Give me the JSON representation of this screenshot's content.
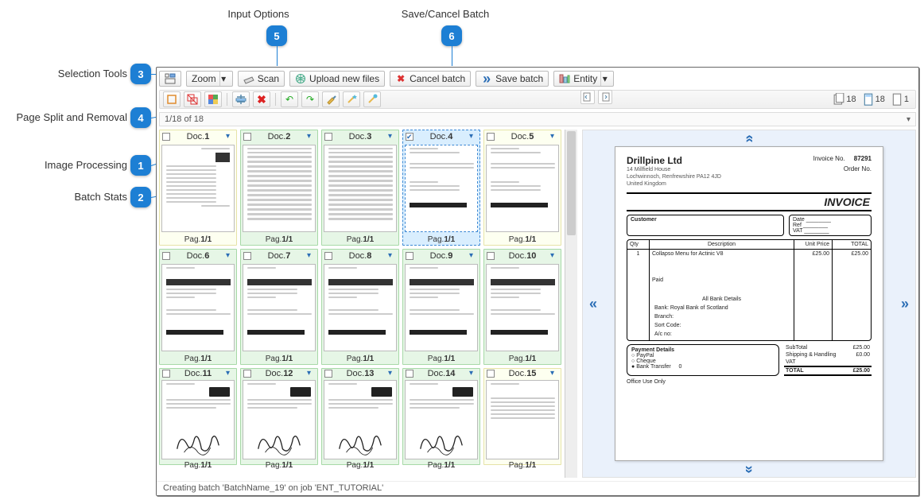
{
  "callouts": {
    "c1": {
      "label": "Image Processing",
      "num": "1"
    },
    "c2": {
      "label": "Batch Stats",
      "num": "2"
    },
    "c3": {
      "label": "Selection Tools",
      "num": "3"
    },
    "c4": {
      "label": "Page Split and Removal",
      "num": "4"
    },
    "c5": {
      "label": "Input Options",
      "num": "5"
    },
    "c6": {
      "label": "Save/Cancel Batch",
      "num": "6"
    }
  },
  "toolbar": {
    "zoom": "Zoom",
    "scan": "Scan",
    "upload": "Upload new files",
    "cancel": "Cancel batch",
    "save": "Save batch",
    "entity": "Entity"
  },
  "stats": {
    "s1": "18",
    "s2": "18",
    "s3": "1"
  },
  "position": "1/18 of 18",
  "docs": [
    {
      "id": "d1",
      "name": "Doc.",
      "num": "1",
      "pag": "Pag.",
      "pp": "1/1",
      "variant": "lite",
      "mock": "inv"
    },
    {
      "id": "d2",
      "name": "Doc.",
      "num": "2",
      "pag": "Pag.",
      "pp": "1/1",
      "variant": "grn",
      "mock": "table"
    },
    {
      "id": "d3",
      "name": "Doc.",
      "num": "3",
      "pag": "Pag.",
      "pp": "1/1",
      "variant": "grn",
      "mock": "table"
    },
    {
      "id": "d4",
      "name": "Doc.",
      "num": "4",
      "pag": "Pag.",
      "pp": "1/1",
      "variant": "sel",
      "mock": "form",
      "checked": true
    },
    {
      "id": "d5",
      "name": "Doc.",
      "num": "5",
      "pag": "Pag.",
      "pp": "1/1",
      "variant": "lite",
      "mock": "form2"
    },
    {
      "id": "d6",
      "name": "Doc.",
      "num": "6",
      "pag": "Pag.",
      "pp": "1/1",
      "variant": "grn",
      "mock": "letter"
    },
    {
      "id": "d7",
      "name": "Doc.",
      "num": "7",
      "pag": "Pag.",
      "pp": "1/1",
      "variant": "grn",
      "mock": "letter"
    },
    {
      "id": "d8",
      "name": "Doc.",
      "num": "8",
      "pag": "Pag.",
      "pp": "1/1",
      "variant": "grn",
      "mock": "letter"
    },
    {
      "id": "d9",
      "name": "Doc.",
      "num": "9",
      "pag": "Pag.",
      "pp": "1/1",
      "variant": "grn",
      "mock": "letter"
    },
    {
      "id": "d10",
      "name": "Doc.",
      "num": "10",
      "pag": "Pag.",
      "pp": "1/1",
      "variant": "grn",
      "mock": "letter"
    },
    {
      "id": "d11",
      "name": "Doc.",
      "num": "11",
      "pag": "Pag.",
      "pp": "1/1",
      "variant": "grn",
      "mock": "scrib"
    },
    {
      "id": "d12",
      "name": "Doc.",
      "num": "12",
      "pag": "Pag.",
      "pp": "1/1",
      "variant": "grn",
      "mock": "scrib"
    },
    {
      "id": "d13",
      "name": "Doc.",
      "num": "13",
      "pag": "Pag.",
      "pp": "1/1",
      "variant": "grn",
      "mock": "scrib"
    },
    {
      "id": "d14",
      "name": "Doc.",
      "num": "14",
      "pag": "Pag.",
      "pp": "1/1",
      "variant": "grn",
      "mock": "scrib"
    },
    {
      "id": "d15",
      "name": "Doc.",
      "num": "15",
      "pag": "Pag.",
      "pp": "1/1",
      "variant": "lite",
      "mock": "google"
    }
  ],
  "invoice": {
    "company": "Drillpine Ltd",
    "addr1": "14 Millfield House",
    "addr2": "Lochwinnoch, Renfrewshire PA12 4JD",
    "addr3": "United Kingdom",
    "invno_lbl": "Invoice No.",
    "invno": "87291",
    "ordno_lbl": "Order No.",
    "title": "INVOICE",
    "cust_lbl": "Customer",
    "date_lbl": "Date",
    "ref_lbl": "Ref",
    "vat_lbl": "VAT",
    "th_qty": "Qty",
    "th_desc": "Description",
    "th_up": "Unit Price",
    "th_tot": "TOTAL",
    "row1_qty": "1",
    "row1_desc": "Collapso Menu for Actinic V8",
    "row1_up": "£25.00",
    "row1_tot": "£25.00",
    "paid": "Paid",
    "bank_hdr": "All Bank Details",
    "bank1": "Bank: Royal Bank of Scotland",
    "bank2": "Branch:",
    "bank3": "Sort Code:",
    "bank4": "A/c no:",
    "pay_hdr": "Payment Details",
    "pay1": "PayPal",
    "pay2": "Cheque",
    "pay3": "Bank Transfer",
    "pay3v": "0",
    "sum_sub_l": "SubTotal",
    "sum_sub_v": "£25.00",
    "sum_ship_l": "Shipping & Handling",
    "sum_ship_v": "£0.00",
    "sum_vat_l": "VAT",
    "sum_vat_v": "",
    "sum_tot_l": "TOTAL",
    "sum_tot_v": "£25.00",
    "office": "Office Use Only"
  },
  "status": "Creating batch 'BatchName_19' on job 'ENT_TUTORIAL'"
}
